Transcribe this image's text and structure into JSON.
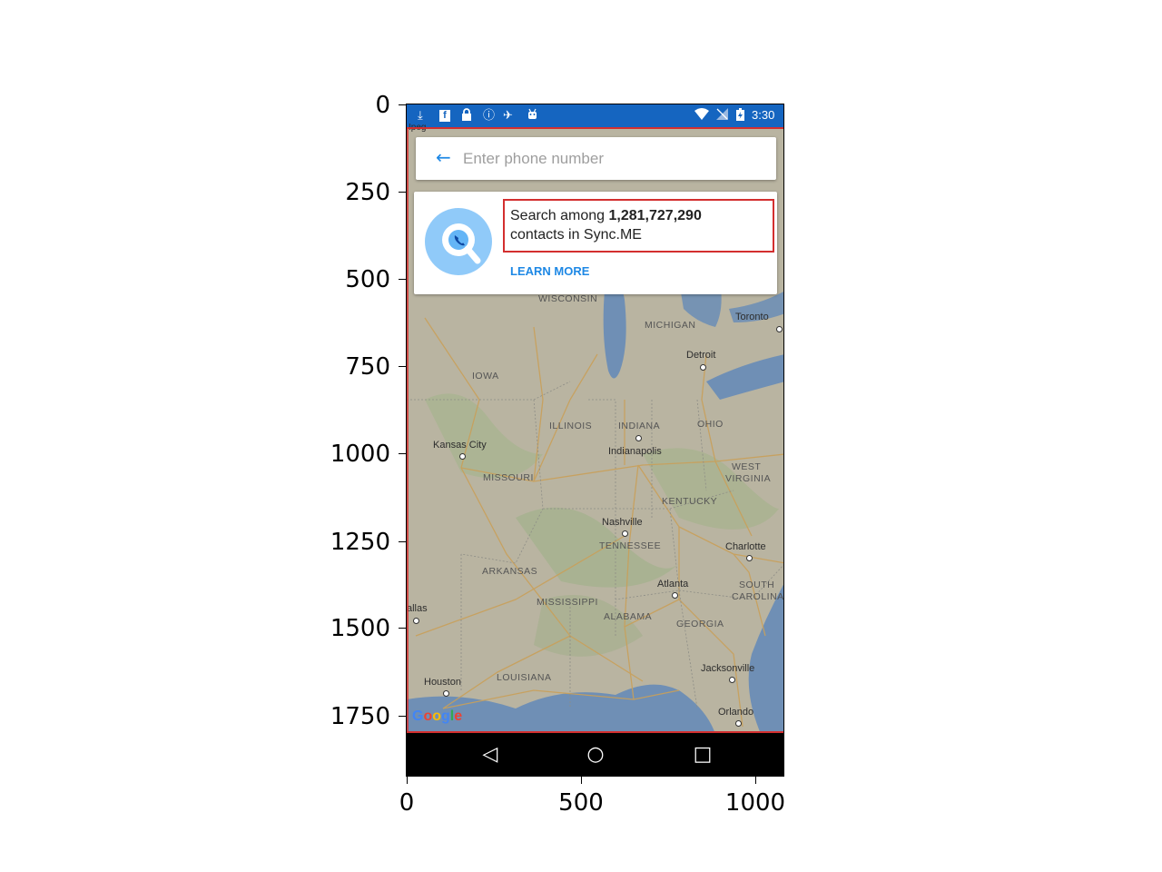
{
  "axes": {
    "y_ticks": [
      "0",
      "250",
      "500",
      "750",
      "1000",
      "1250",
      "1500",
      "1750"
    ],
    "x_ticks": [
      "0",
      "500",
      "1000"
    ]
  },
  "status_bar": {
    "time": "3:30",
    "left_icons": [
      "download-icon",
      "facebook-icon",
      "lock-icon",
      "info-icon",
      "satellite-icon",
      "android-icon"
    ],
    "right_icons": [
      "wifi-icon",
      "no-signal-icon",
      "battery-icon"
    ]
  },
  "search": {
    "placeholder": "Enter phone number",
    "back_icon": "back-arrow-icon"
  },
  "promo": {
    "text_prefix": "Search among ",
    "count": "1,281,727,290",
    "text_suffix": "contacts in Sync.ME",
    "learn_more": "LEARN MORE"
  },
  "map": {
    "labels": {
      "wisconsin": "WISCONSIN",
      "michigan": "MICHIGAN",
      "toronto": "Toronto",
      "detroit": "Detroit",
      "iowa": "IOWA",
      "illinois": "ILLINOIS",
      "indiana": "INDIANA",
      "ohio": "OHIO",
      "kansas_city": "Kansas City",
      "indianapolis": "Indianapolis",
      "missouri": "MISSOURI",
      "west_virginia_1": "WEST",
      "west_virginia_2": "VIRGINIA",
      "kentucky": "KENTUCKY",
      "nashville": "Nashville",
      "tennessee": "TENNESSEE",
      "charlotte": "Charlotte",
      "arkansas": "ARKANSAS",
      "atlanta": "Atlanta",
      "south_carolina_1": "SOUTH",
      "south_carolina_2": "CAROLINA",
      "dallas": "allas",
      "mississippi": "MISSISSIPPI",
      "alabama": "ALABAMA",
      "georgia": "GEORGIA",
      "houston": "Houston",
      "louisiana": "LOUISIANA",
      "jacksonville": "Jacksonville",
      "orlando": "Orlando",
      "winnipeg": "Ipeg"
    },
    "google_logo": "Google"
  },
  "nav": {
    "back_icon": "◁",
    "home_icon": "○",
    "recents_icon": "□"
  },
  "colors": {
    "status_bar": "#1565c0",
    "accent": "#1e88e5",
    "highlight": "#d32f2f"
  }
}
